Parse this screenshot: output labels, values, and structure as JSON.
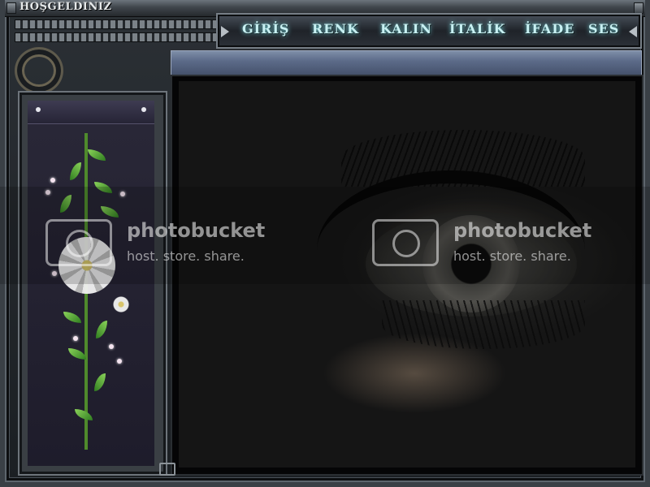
{
  "window": {
    "title": "HOŞGELDINIZ"
  },
  "menu": {
    "items": [
      {
        "label": "GİRİŞ"
      },
      {
        "label": "RENK"
      },
      {
        "label": "KALIN"
      },
      {
        "label": "İTALİK"
      },
      {
        "label": "İFADE"
      },
      {
        "label": "SES"
      }
    ]
  },
  "watermark": {
    "brand": "photobucket",
    "tagline": "host. store. share."
  },
  "icons": {
    "decor": [
      "rivet-icon",
      "chain-icon",
      "ornament-icon",
      "flower-icon",
      "photobucket-logo-icon",
      "corner-tab-icon"
    ]
  },
  "colors": {
    "menu_text": "#c8f0f2",
    "frame": "#3a4046",
    "strip": "#5c6b89"
  }
}
